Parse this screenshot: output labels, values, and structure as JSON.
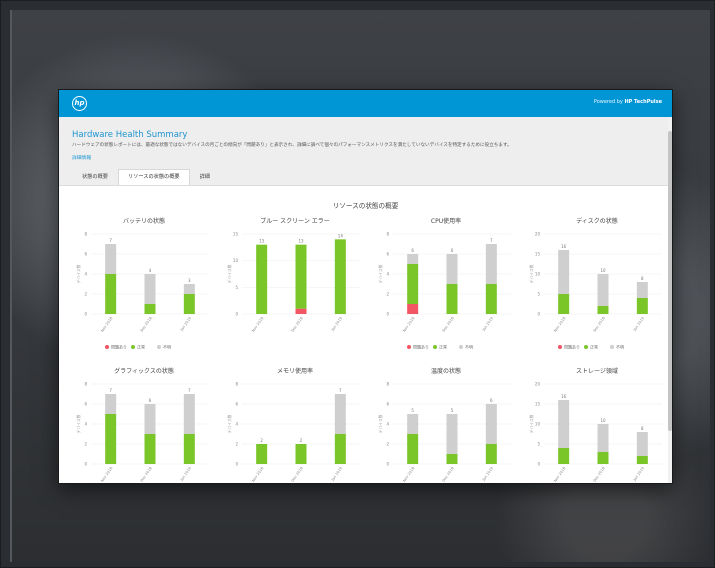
{
  "app": {
    "logo": "hp",
    "powered_prefix": "Powered by",
    "powered_brand": "HP TechPulse"
  },
  "header": {
    "title": "Hardware Health Summary",
    "description": "ハードウェアの状態レポートには、最適な状態ではないデバイスの月ごとの傾向が「問題あり」と表示され、詳細に調べて個々のパフォーマンスメトリクスを満たしていないデバイスを特定するために役立ちます。",
    "details_link": "詳細情報"
  },
  "tabs": [
    {
      "label": "状態の概要",
      "active": false
    },
    {
      "label": "リソースの状態の概要",
      "active": true
    },
    {
      "label": "詳細",
      "active": false
    }
  ],
  "section_title": "リソースの状態の概要",
  "legend_labels": [
    "問題あり",
    "正常",
    "不明"
  ],
  "colors": {
    "issue": "#f25563",
    "healthy": "#7ac528",
    "unknown": "#cfcfcf",
    "accent": "#0096d6"
  },
  "chart_data": [
    {
      "type": "bar",
      "stacked": true,
      "title": "バッテリの状態",
      "ylabel": "デバイス数",
      "categories": [
        "Nov 2018",
        "Dec 2018",
        "Jan 2019"
      ],
      "yticks": [
        0,
        2,
        4,
        6,
        8
      ],
      "ylim": [
        0,
        8
      ],
      "series": [
        {
          "name": "問題あり",
          "values": [
            0,
            0,
            0
          ]
        },
        {
          "name": "正常",
          "values": [
            4,
            1,
            2
          ]
        },
        {
          "name": "不明",
          "values": [
            3,
            3,
            1
          ]
        }
      ],
      "totals": [
        7,
        4,
        3
      ],
      "legend": true
    },
    {
      "type": "bar",
      "stacked": true,
      "title": "ブルー スクリーン エラー",
      "ylabel": "デバイス数",
      "categories": [
        "Nov 2018",
        "Dec 2018",
        "Jan 2019"
      ],
      "yticks": [
        0,
        5,
        10,
        15
      ],
      "ylim": [
        0,
        15
      ],
      "series": [
        {
          "name": "問題あり",
          "values": [
            0,
            1,
            0
          ]
        },
        {
          "name": "正常",
          "values": [
            13,
            12,
            14
          ]
        },
        {
          "name": "不明",
          "values": [
            0,
            0,
            0
          ]
        }
      ],
      "totals": [
        13,
        13,
        14
      ],
      "legend": false
    },
    {
      "type": "bar",
      "stacked": true,
      "title": "CPU使用率",
      "ylabel": "デバイス数",
      "categories": [
        "Nov 2018",
        "Dec 2018",
        "Jan 2019"
      ],
      "yticks": [
        0,
        2,
        4,
        6,
        8
      ],
      "ylim": [
        0,
        8
      ],
      "series": [
        {
          "name": "問題あり",
          "values": [
            1,
            0,
            0
          ]
        },
        {
          "name": "正常",
          "values": [
            4,
            3,
            3
          ]
        },
        {
          "name": "不明",
          "values": [
            1,
            3,
            4
          ]
        }
      ],
      "totals": [
        6,
        6,
        7
      ],
      "legend": true
    },
    {
      "type": "bar",
      "stacked": true,
      "title": "ディスクの状態",
      "ylabel": "デバイス数",
      "categories": [
        "Nov 2018",
        "Dec 2018",
        "Jan 2019"
      ],
      "yticks": [
        0,
        5,
        10,
        15,
        20
      ],
      "ylim": [
        0,
        20
      ],
      "series": [
        {
          "name": "問題あり",
          "values": [
            0,
            0,
            0
          ]
        },
        {
          "name": "正常",
          "values": [
            5,
            2,
            4
          ]
        },
        {
          "name": "不明",
          "values": [
            11,
            8,
            4
          ]
        }
      ],
      "totals": [
        16,
        10,
        8
      ],
      "legend": true
    },
    {
      "type": "bar",
      "stacked": true,
      "title": "グラフィックスの状態",
      "ylabel": "デバイス数",
      "categories": [
        "Nov 2018",
        "Dec 2018",
        "Jan 2019"
      ],
      "yticks": [
        0,
        2,
        4,
        6,
        8
      ],
      "ylim": [
        0,
        8
      ],
      "series": [
        {
          "name": "問題あり",
          "values": [
            0,
            0,
            0
          ]
        },
        {
          "name": "正常",
          "values": [
            5,
            3,
            3
          ]
        },
        {
          "name": "不明",
          "values": [
            2,
            3,
            4
          ]
        }
      ],
      "totals": [
        7,
        6,
        7
      ],
      "legend": false
    },
    {
      "type": "bar",
      "stacked": true,
      "title": "メモリ使用率",
      "ylabel": "デバイス数",
      "categories": [
        "Nov 2018",
        "Dec 2018",
        "Jan 2019"
      ],
      "yticks": [
        0,
        2,
        4,
        6,
        8
      ],
      "ylim": [
        0,
        8
      ],
      "series": [
        {
          "name": "問題あり",
          "values": [
            0,
            0,
            0
          ]
        },
        {
          "name": "正常",
          "values": [
            2,
            2,
            3
          ]
        },
        {
          "name": "不明",
          "values": [
            0,
            0,
            4
          ]
        }
      ],
      "totals": [
        2,
        2,
        7
      ],
      "legend": false
    },
    {
      "type": "bar",
      "stacked": true,
      "title": "温度の状態",
      "ylabel": "デバイス数",
      "categories": [
        "Nov 2018",
        "Dec 2018",
        "Jan 2019"
      ],
      "yticks": [
        0,
        2,
        4,
        6,
        8
      ],
      "ylim": [
        0,
        8
      ],
      "series": [
        {
          "name": "問題あり",
          "values": [
            0,
            0,
            0
          ]
        },
        {
          "name": "正常",
          "values": [
            3,
            1,
            2
          ]
        },
        {
          "name": "不明",
          "values": [
            2,
            4,
            4
          ]
        }
      ],
      "totals": [
        5,
        5,
        6
      ],
      "legend": false
    },
    {
      "type": "bar",
      "stacked": true,
      "title": "ストレージ領域",
      "ylabel": "デバイス数",
      "categories": [
        "Nov 2018",
        "Dec 2018",
        "Jan 2019"
      ],
      "yticks": [
        0,
        5,
        10,
        15,
        20
      ],
      "ylim": [
        0,
        20
      ],
      "series": [
        {
          "name": "問題あり",
          "values": [
            0,
            0,
            0
          ]
        },
        {
          "name": "正常",
          "values": [
            4,
            3,
            2
          ]
        },
        {
          "name": "不明",
          "values": [
            12,
            7,
            6
          ]
        }
      ],
      "totals": [
        16,
        10,
        8
      ],
      "legend": false
    }
  ]
}
